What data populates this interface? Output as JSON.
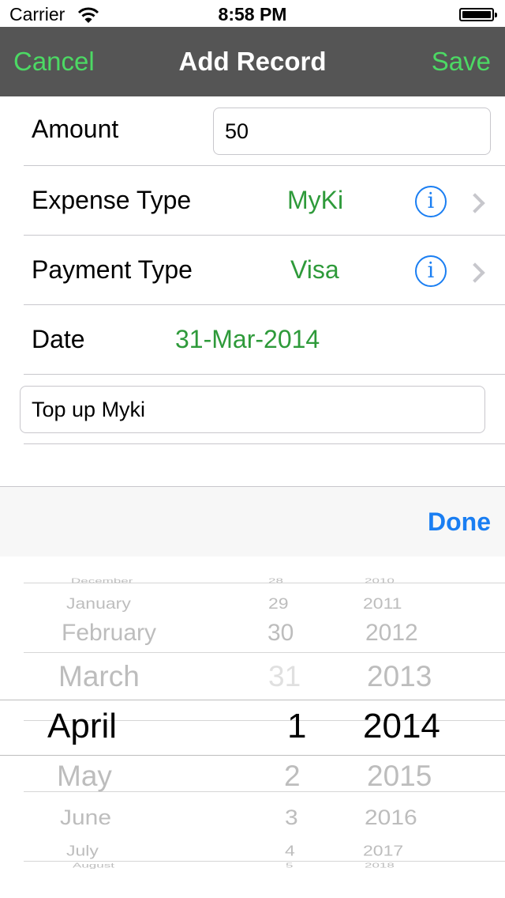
{
  "status_bar": {
    "carrier": "Carrier",
    "time": "8:58 PM"
  },
  "nav": {
    "cancel_label": "Cancel",
    "title": "Add Record",
    "save_label": "Save"
  },
  "form": {
    "amount": {
      "label": "Amount",
      "value": "50"
    },
    "expense_type": {
      "label": "Expense Type",
      "value": "MyKi",
      "info_glyph": "i"
    },
    "payment_type": {
      "label": "Payment Type",
      "value": "Visa",
      "info_glyph": "i"
    },
    "date": {
      "label": "Date",
      "value": "31-Mar-2014"
    },
    "note": {
      "value": "Top up Myki"
    }
  },
  "toolbar": {
    "done_label": "Done"
  },
  "picker": {
    "months": [
      "December",
      "January",
      "February",
      "March",
      "April",
      "May",
      "June",
      "July",
      "August"
    ],
    "days": [
      "28",
      "29",
      "30",
      "31",
      "1",
      "2",
      "3",
      "4",
      "5"
    ],
    "years": [
      "2010",
      "2011",
      "2012",
      "2013",
      "2014",
      "2015",
      "2016",
      "2017",
      "2018"
    ],
    "selected": {
      "month": "April",
      "day": "1",
      "year": "2014"
    }
  },
  "colors": {
    "nav_bg": "#555555",
    "nav_buttons": "#4cd964",
    "value_green": "#2e9a3a",
    "ios_blue": "#1a7ef2"
  }
}
